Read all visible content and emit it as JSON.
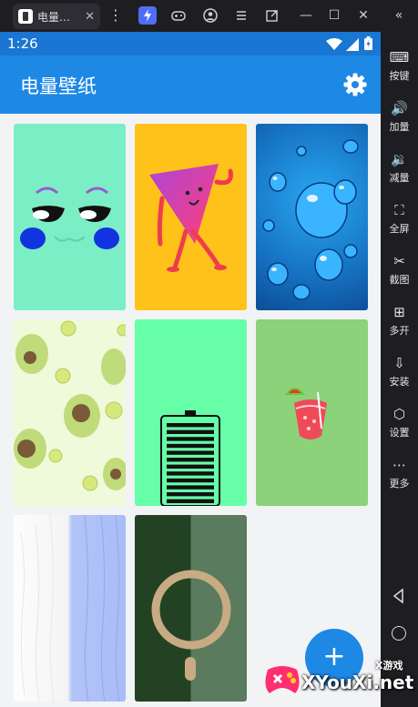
{
  "window": {
    "tab_title": "电量…",
    "tab_close": "✕",
    "kebab": "⋮",
    "min": "—",
    "max": "☐",
    "close": "✕",
    "collapse": "«"
  },
  "toolbar": {
    "items": [
      {
        "icon": "keyboard-icon",
        "glyph": "⌨",
        "label": "按键"
      },
      {
        "icon": "volume-up-icon",
        "glyph": "🔊",
        "label": "加量"
      },
      {
        "icon": "volume-down-icon",
        "glyph": "🔉",
        "label": "减量"
      },
      {
        "icon": "fullscreen-icon",
        "glyph": "⛶",
        "label": "全屏"
      },
      {
        "icon": "scissors-icon",
        "glyph": "✂",
        "label": "截图"
      },
      {
        "icon": "multi-open-icon",
        "glyph": "⊞",
        "label": "多开"
      },
      {
        "icon": "apk-install-icon",
        "glyph": "⇩",
        "label": "安装"
      },
      {
        "icon": "settings-hex-icon",
        "glyph": "⬡",
        "label": "设置"
      },
      {
        "icon": "more-icon",
        "glyph": "⋯",
        "label": "更多"
      }
    ]
  },
  "status": {
    "time": "1:26"
  },
  "app": {
    "title": "电量壁纸",
    "fab": "+"
  },
  "wallpapers": [
    {
      "name": "cartoon-face"
    },
    {
      "name": "pink-triangle-character"
    },
    {
      "name": "water-drops"
    },
    {
      "name": "avocado-kiwi-pattern"
    },
    {
      "name": "battery-level"
    },
    {
      "name": "strawberry-drink"
    },
    {
      "name": "white-blue-paint"
    },
    {
      "name": "magsafe-ring"
    }
  ],
  "battery": {
    "level": 1.0
  },
  "watermark": {
    "brand": "XYouXi.net",
    "small": "X游戏"
  },
  "colors": {
    "primary": "#1e88e5",
    "status": "#1976d2",
    "background": "#f2f3f5"
  }
}
